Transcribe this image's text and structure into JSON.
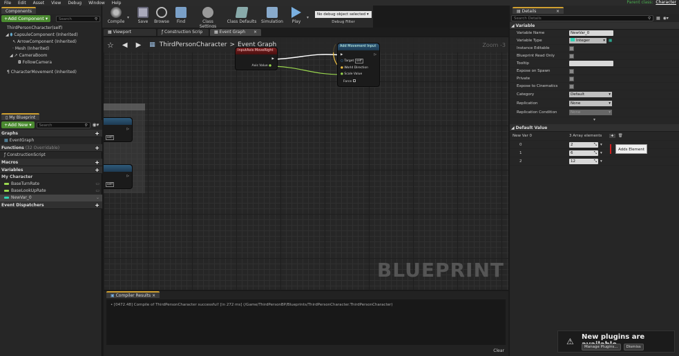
{
  "menu": [
    "File",
    "Edit",
    "Asset",
    "View",
    "Debug",
    "Window",
    "Help"
  ],
  "parent": {
    "label": "Parent class:",
    "value": "Character"
  },
  "components": {
    "tab": "Components",
    "add_label": "+Add Component ▾",
    "search_placeholder": "Search",
    "self": "ThirdPersonCharacter(self)",
    "items": [
      "CapsuleComponent (Inherited)",
      "ArrowComponent (Inherited)",
      "Mesh (Inherited)",
      "CameraBoom",
      "FollowCamera",
      "CharacterMovement (Inherited)"
    ]
  },
  "myblueprint": {
    "tab": "My Blueprint",
    "add_label": "+Add New ▾",
    "search_placeholder": "Search",
    "graphs_label": "Graphs",
    "event_graph": "EventGraph",
    "functions_label": "Functions",
    "functions_note": "(32 Overridable)",
    "construction_script": "ConstructionScript",
    "macros_label": "Macros",
    "variables_label": "Variables",
    "category": "My Character",
    "vars": [
      "BaseTurnRate",
      "BaseLookUpRate",
      "NewVar_0"
    ],
    "dispatchers_label": "Event Dispatchers"
  },
  "toolbar": {
    "compile": "Compile",
    "save": "Save",
    "browse": "Browse",
    "find": "Find",
    "class_settings": "Class Settings",
    "class_defaults": "Class Defaults",
    "simulation": "Simulation",
    "play": "Play",
    "debug_select": "No debug object selected ▾",
    "debug_filter": "Debug Filter"
  },
  "graph_tabs": [
    "Viewport",
    "Construction Scrip",
    "Event Graph"
  ],
  "breadcrumb": {
    "root": "ThirdPersonCharacter",
    "sep": ">",
    "current": "Event Graph",
    "zoom": "Zoom -3"
  },
  "nodes": {
    "input_node_title": "InputAxis MoveRight",
    "axis_value": "Axis Value",
    "add_movement_title": "Add Movement Input",
    "target": "Target",
    "self": "self",
    "world_direction": "World Direction",
    "scale_value": "Scale Value",
    "force": "Force",
    "left_node_self": "self"
  },
  "watermark": "BLUEPRINT",
  "compiler": {
    "tab": "Compiler Results",
    "log": "[0472.48] Compile of ThirdPersonCharacter successful! [in 272 ms] (/Game/ThirdPersonBP/Blueprints/ThirdPersonCharacter.ThirdPersonCharacter)",
    "clear": "Clear"
  },
  "details": {
    "tab": "Details",
    "search_placeholder": "Search Details",
    "variable_section": "Variable",
    "rows": {
      "name_label": "Variable Name",
      "name_value": "NewVar_0",
      "type_label": "Variable Type",
      "type_value": "Integer",
      "instance_editable": "Instance Editable",
      "bp_readonly": "Blueprint Read Only",
      "tooltip": "Tooltip",
      "expose_spawn": "Expose on Spawn",
      "private": "Private",
      "expose_cine": "Expose to Cinematics",
      "category_label": "Category",
      "category_value": "Default",
      "replication_label": "Replication",
      "replication_value": "None",
      "rep_cond_label": "Replication Condition",
      "rep_cond_value": "None"
    },
    "default_section": "Default Value",
    "array_label": "New Var 0",
    "array_count": "3 Array elements",
    "elements": [
      {
        "index": "0",
        "value": "2"
      },
      {
        "index": "1",
        "value": "6"
      },
      {
        "index": "2",
        "value": "12"
      }
    ],
    "tooltip_text": "Adds Element"
  },
  "notification": {
    "title": "New plugins are available",
    "manage": "Manage Plugins...",
    "dismiss": "Dismiss"
  }
}
